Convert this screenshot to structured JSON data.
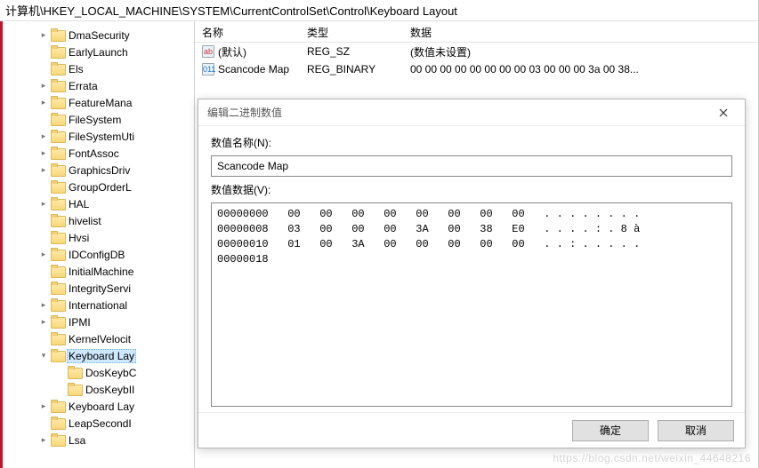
{
  "address": "计算机\\HKEY_LOCAL_MACHINE\\SYSTEM\\CurrentControlSet\\Control\\Keyboard Layout",
  "tree": [
    {
      "label": "DmaSecurity",
      "expander": ">",
      "indent": 0
    },
    {
      "label": "EarlyLaunch",
      "expander": "",
      "indent": 0
    },
    {
      "label": "Els",
      "expander": "",
      "indent": 0
    },
    {
      "label": "Errata",
      "expander": ">",
      "indent": 0
    },
    {
      "label": "FeatureMana",
      "expander": ">",
      "indent": 0
    },
    {
      "label": "FileSystem",
      "expander": "",
      "indent": 0
    },
    {
      "label": "FileSystemUti",
      "expander": ">",
      "indent": 0
    },
    {
      "label": "FontAssoc",
      "expander": ">",
      "indent": 0
    },
    {
      "label": "GraphicsDriv",
      "expander": ">",
      "indent": 0
    },
    {
      "label": "GroupOrderL",
      "expander": "",
      "indent": 0
    },
    {
      "label": "HAL",
      "expander": ">",
      "indent": 0
    },
    {
      "label": "hivelist",
      "expander": "",
      "indent": 0
    },
    {
      "label": "Hvsi",
      "expander": "",
      "indent": 0
    },
    {
      "label": "IDConfigDB",
      "expander": ">",
      "indent": 0
    },
    {
      "label": "InitialMachine",
      "expander": "",
      "indent": 0
    },
    {
      "label": "IntegrityServi",
      "expander": "",
      "indent": 0
    },
    {
      "label": "International",
      "expander": ">",
      "indent": 0
    },
    {
      "label": "IPMI",
      "expander": ">",
      "indent": 0
    },
    {
      "label": "KernelVelocit",
      "expander": "",
      "indent": 0
    },
    {
      "label": "Keyboard Lay",
      "expander": "v",
      "indent": 0,
      "selected": true
    },
    {
      "label": "DosKeybC",
      "expander": "",
      "indent": 1
    },
    {
      "label": "DosKeybII",
      "expander": "",
      "indent": 1
    },
    {
      "label": "Keyboard Lay",
      "expander": ">",
      "indent": 0
    },
    {
      "label": "LeapSecondI",
      "expander": "",
      "indent": 0
    },
    {
      "label": "Lsa",
      "expander": ">",
      "indent": 0
    }
  ],
  "list": {
    "cols": {
      "name": "名称",
      "type": "类型",
      "data": "数据"
    },
    "rows": [
      {
        "iconClass": "sz",
        "iconText": "ab",
        "name": "(默认)",
        "type": "REG_SZ",
        "data": "(数值未设置)"
      },
      {
        "iconClass": "bin",
        "iconText": "011",
        "name": "Scancode Map",
        "type": "REG_BINARY",
        "data": "00 00 00 00 00 00 00 00 03 00 00 00 3a 00 38..."
      }
    ]
  },
  "dialog": {
    "title": "编辑二进制数值",
    "nameLabel": "数值名称(N):",
    "nameValue": "Scancode Map",
    "dataLabel": "数值数据(V):",
    "hex": "00000000   00   00   00   00   00   00   00   00   . . . . . . . .\n00000008   03   00   00   00   3A   00   38   E0   . . . . : . 8 à\n00000010   01   00   3A   00   00   00   00   00   . . : . . . . .\n00000018",
    "ok": "确定",
    "cancel": "取消"
  },
  "watermark": "https://blog.csdn.net/weixin_44648216"
}
